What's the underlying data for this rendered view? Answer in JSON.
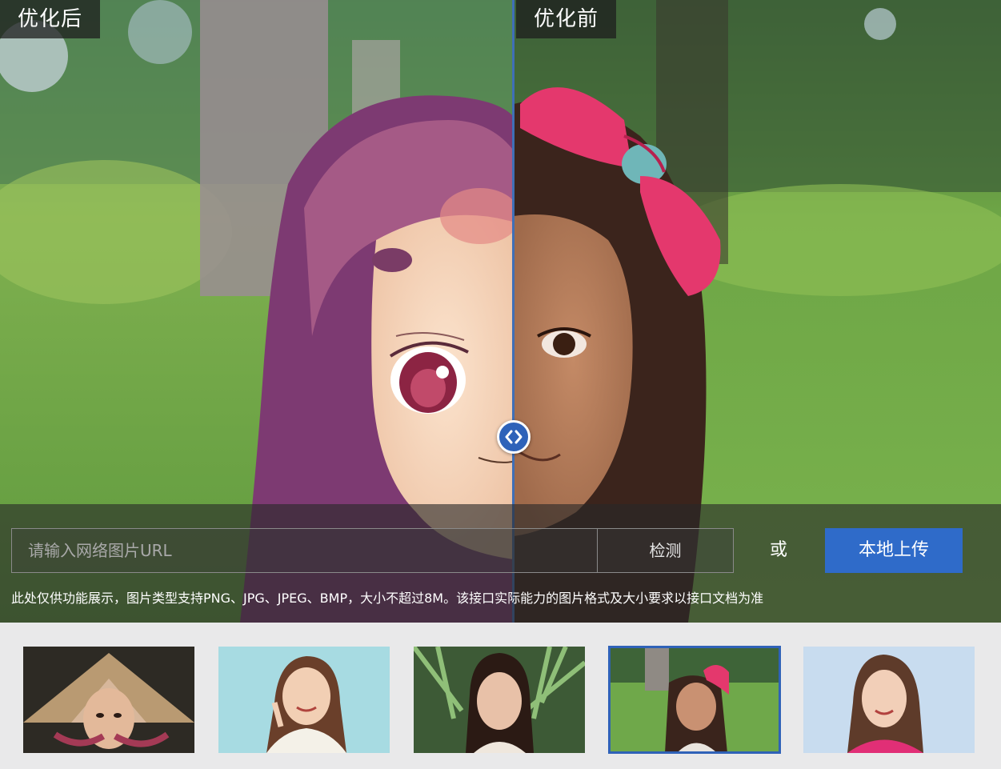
{
  "labels": {
    "after": "优化后",
    "before": "优化前"
  },
  "controls": {
    "url_placeholder": "请输入网络图片URL",
    "detect_label": "检测",
    "or_label": "或",
    "upload_label": "本地上传",
    "note": "此处仅供功能展示，图片类型支持PNG、JPG、JPEG、BMP，大小不超过8M。该接口实际能力的图片格式及大小要求以接口文档为准"
  },
  "thumbnails": {
    "selected_index": 3
  },
  "colors": {
    "accent": "#2f6bc9",
    "divider": "#3f6fb7"
  }
}
